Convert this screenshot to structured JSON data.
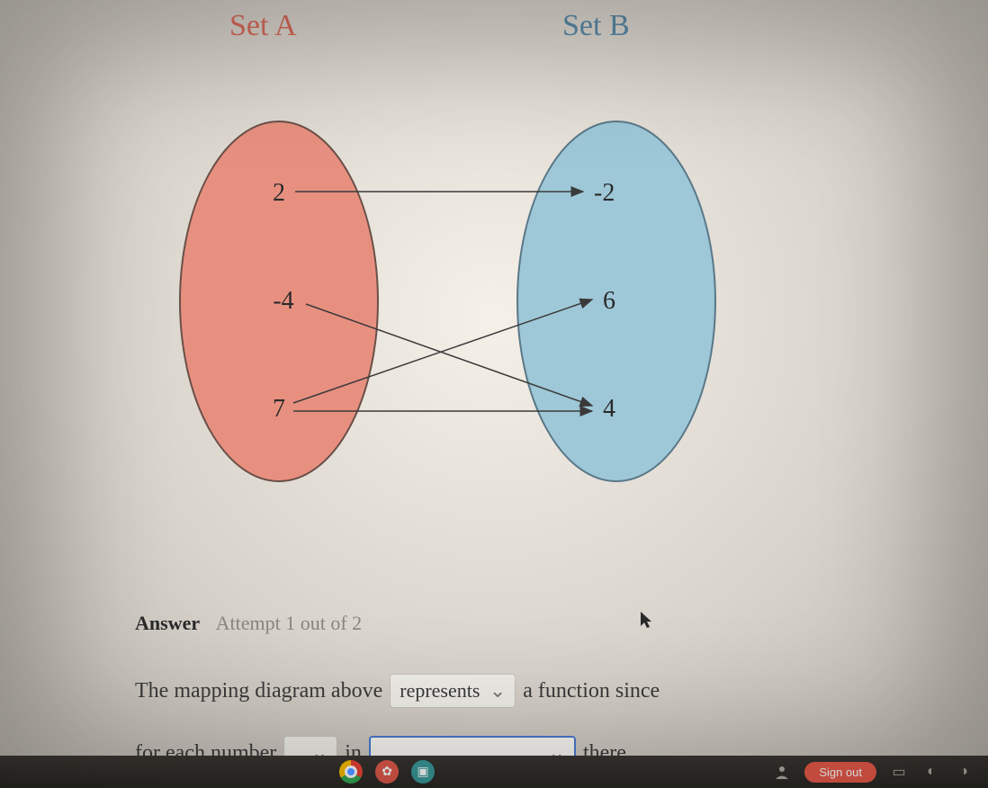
{
  "setA": {
    "label": "Set A",
    "color": "#d86a5a",
    "values": [
      "2",
      "-4",
      "7"
    ]
  },
  "setB": {
    "label": "Set B",
    "color": "#5a8aa8",
    "values": [
      "-2",
      "6",
      "4"
    ]
  },
  "mappings": [
    {
      "from": "2",
      "to": "-2"
    },
    {
      "from": "-4",
      "to": "4"
    },
    {
      "from": "7",
      "to": "6"
    },
    {
      "from": "7",
      "to": "4"
    }
  ],
  "answer": {
    "heading": "Answer",
    "attempt": "Attempt 1 out of 2",
    "line1_pre": "The mapping diagram above",
    "dd1": "represents",
    "line1_post": "a function since",
    "line2_pre": "for each number",
    "dd2": "",
    "line2_mid": "in",
    "dd3": "",
    "line2_post": "there"
  },
  "taskbar": {
    "signout": "Sign out"
  }
}
